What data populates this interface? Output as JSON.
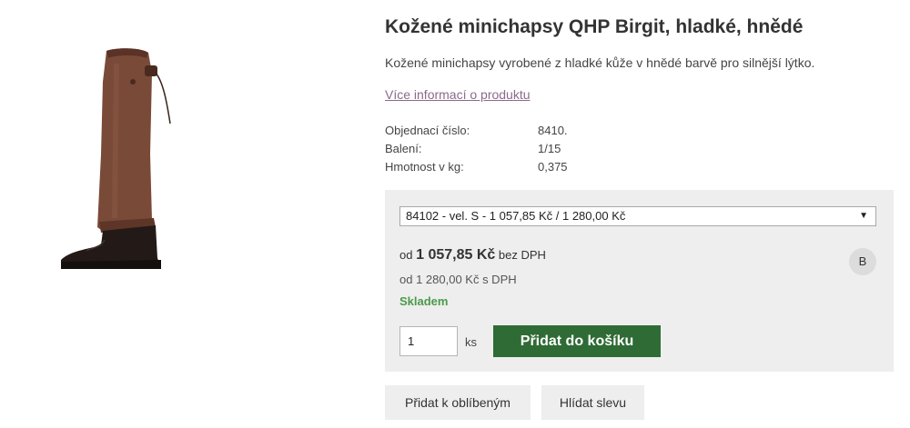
{
  "product": {
    "title": "Kožené minichapsy QHP Birgit, hladké, hnědé",
    "description": "Kožené minichapsy vyrobené z hladké kůže v hnědé barvě pro silnější lýtko.",
    "more_info_link": "Více informací o produktu",
    "image_icon": "leather-half-chaps-on-boot"
  },
  "params": [
    {
      "label": "Objednací číslo:",
      "value": "8410."
    },
    {
      "label": "Balení:",
      "value": "1/15"
    },
    {
      "label": "Hmotnost v kg:",
      "value": "0,375"
    }
  ],
  "buy_box": {
    "variant_selected": "84102 - vel. S - 1 057,85 Kč / 1 280,00 Kč",
    "price_prefix": "od",
    "price_excl_vat": "1 057,85 Kč",
    "price_excl_vat_suffix": "bez DPH",
    "price_incl_vat": "od 1 280,00 Kč s DPH",
    "stock_status": "Skladem",
    "badge": "B",
    "quantity": "1",
    "quantity_unit": "ks",
    "add_to_cart_label": "Přidat do košíku"
  },
  "actions": {
    "favorite_label": "Přidat k oblíbeným",
    "price_watch_label": "Hlídat slevu"
  },
  "colors": {
    "accent_green": "#2f6b35",
    "stock_green": "#4a9a4a",
    "link_purple": "#8b6a8b",
    "panel_gray": "#eeeeee"
  }
}
